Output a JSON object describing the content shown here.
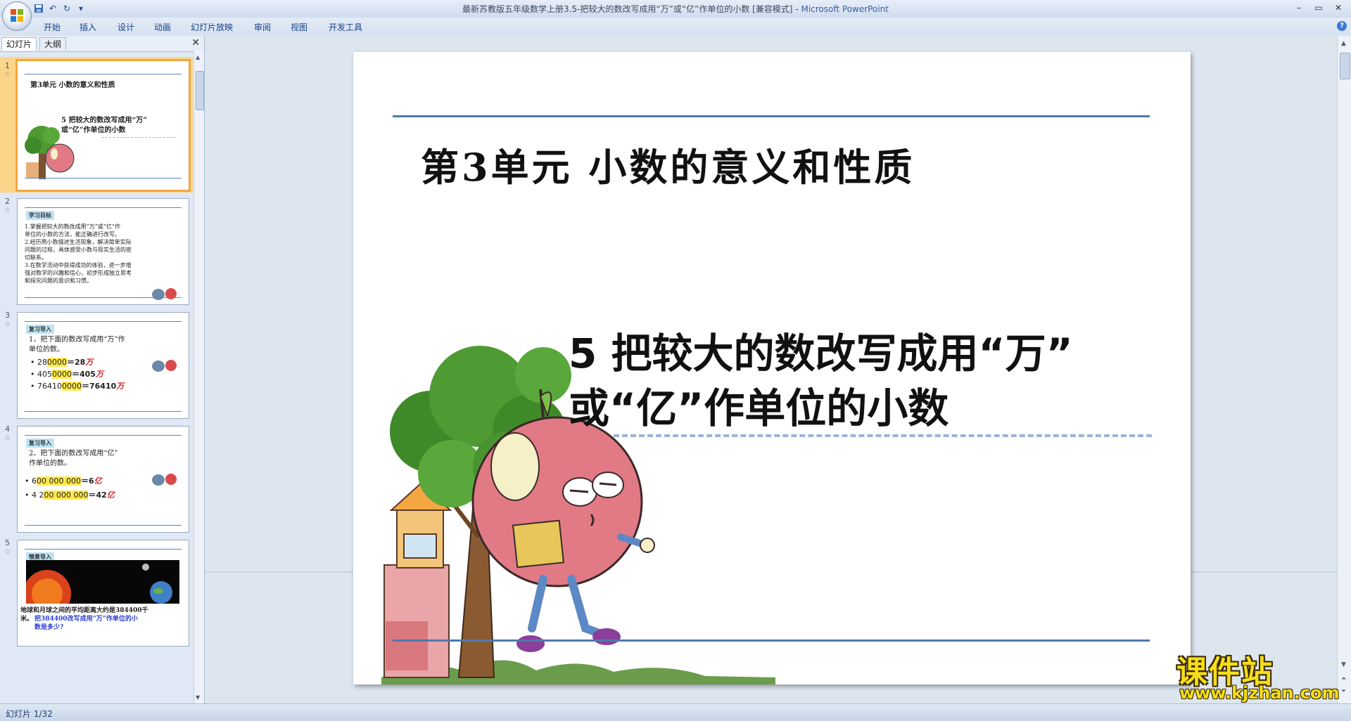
{
  "window": {
    "title": "最新苏教版五年级数学上册3.5-把较大的数改写成用“万”或“亿”作单位的小数 [兼容模式]",
    "app_name": "Microsoft PowerPoint",
    "minimize": "–",
    "restore": "▭",
    "close": "✕"
  },
  "qat": {
    "save_icon": "save-icon",
    "undo": "↶",
    "redo": "↻",
    "more": "▾"
  },
  "ribbon": {
    "tabs": [
      "开始",
      "插入",
      "设计",
      "动画",
      "幻灯片放映",
      "审阅",
      "视图",
      "开发工具"
    ],
    "help": "?"
  },
  "left_pane": {
    "tabs": [
      "幻灯片",
      "大纲"
    ],
    "close": "✕",
    "slides": [
      {
        "num": "1",
        "star": "☆",
        "title": "第3单元 小数的意义和性质",
        "subtitle_1": "5 把较大的数改写成用“万”",
        "subtitle_2": "或“亿”作单位的小数"
      },
      {
        "num": "2",
        "star": "☆",
        "tag": "学习目标",
        "lines": [
          "1.掌握把较大的数改成用“万”或“亿”作",
          "单位的小数的方法，能正确进行改写。",
          "2.经历用小数描述生活现象，解决简单实际",
          "问题的过程，具体感受小数与现实生活的密",
          "切联系。",
          "3.在数学活动中获得成功的体验，进一步增",
          "强对数学的兴趣和信心，初步形成独立思考",
          "和探究问题的意识和习惯。"
        ]
      },
      {
        "num": "3",
        "star": "☆",
        "tag": "复习导入",
        "q1": "1、把下面的数改写成用“万”作",
        "q2": "单位的数。",
        "rows": [
          {
            "a": "• 28",
            "b": "0000",
            "c": "＝28",
            "u": "万"
          },
          {
            "a": "• 405",
            "b": "0000",
            "c": "＝405",
            "u": "万"
          },
          {
            "a": "• 76410",
            "b": "0000",
            "c": "＝76410",
            "u": "万"
          }
        ]
      },
      {
        "num": "4",
        "star": "☆",
        "tag": "复习导入",
        "q1": "2、把下面的数改写成用“亿”",
        "q2": "作单位的数。",
        "rows": [
          {
            "a": "• 6",
            "b": "00 000 000",
            "c": "＝6",
            "u": "亿"
          },
          {
            "a": "• 4 2",
            "b": "00 000 000",
            "c": "＝42",
            "u": "亿"
          }
        ]
      },
      {
        "num": "5",
        "star": "☆",
        "tag": "情景导入",
        "text_1": "地球和月球之间的平均距离大约是384400千",
        "text_2": "米。",
        "text_3": "把384400改写成用“万”作单位的小",
        "text_4": "数是多少?"
      }
    ]
  },
  "slide": {
    "unit_title": "第3单元  小数的意义和性质",
    "lesson_line_1": "5    把较大的数改写成用“万”",
    "lesson_line_2": "或“亿”作单位的小数",
    "art": "apple-character-under-tree"
  },
  "watermark": {
    "title": "课件站",
    "url": "www.kjzhan.com"
  },
  "status": {
    "slide_counter": "幻灯片 1/32"
  },
  "colors": {
    "accent_rule": "#4f79ad",
    "selected_thumb": "#f4a640",
    "watermark": "#f6de1a"
  }
}
